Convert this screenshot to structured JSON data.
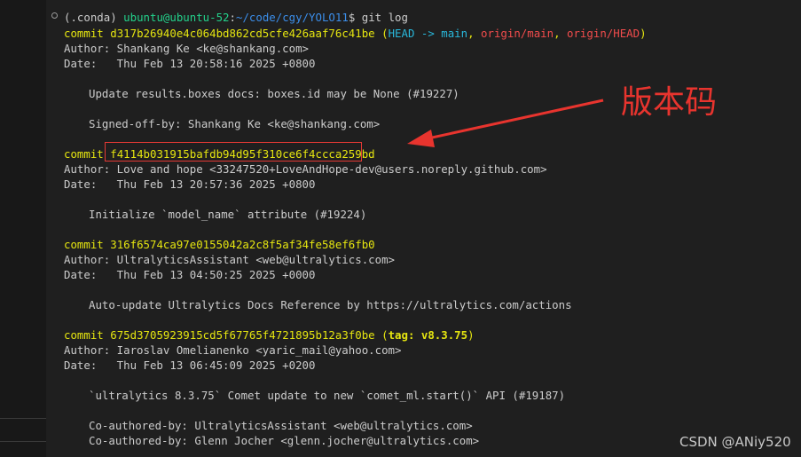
{
  "prompt": {
    "env": "(.conda)",
    "user_host": "ubuntu@ubuntu-52",
    "path": "~/code/cgy/YOLO11",
    "symbol": "$",
    "command": "git log"
  },
  "commits": [
    {
      "hash": "d317b26940e4c064bd862cd5cfe426aaf76c41be",
      "refs": {
        "head": "HEAD -> main",
        "remote1": "origin/main",
        "remote2": "origin/HEAD"
      },
      "author": "Author: Shankang Ke <ke@shankang.com>",
      "date": "Date:   Thu Feb 13 20:58:16 2025 +0800",
      "message": "Update results.boxes docs: boxes.id may be None (#19227)",
      "trailer1": "Signed-off-by: Shankang Ke <ke@shankang.com>"
    },
    {
      "hash": "f4114b031915bafdb94d95f310ce6f4ccca259bd",
      "author": "Author: Love and hope <33247520+LoveAndHope-dev@users.noreply.github.com>",
      "date": "Date:   Thu Feb 13 20:57:36 2025 +0800",
      "message": "Initialize `model_name` attribute (#19224)"
    },
    {
      "hash": "316f6574ca97e0155042a2c8f5af34fe58ef6fb0",
      "author": "Author: UltralyticsAssistant <web@ultralytics.com>",
      "date": "Date:   Thu Feb 13 04:50:25 2025 +0000",
      "message": "Auto-update Ultralytics Docs Reference by https://ultralytics.com/actions"
    },
    {
      "hash": "675d3705923915cd5f67765f4721895b12a3f0be",
      "tag": "tag: v8.3.75",
      "author": "Author: Iaroslav Omelianenko <yaric_mail@yahoo.com>",
      "date": "Date:   Thu Feb 13 06:45:09 2025 +0200",
      "message": "`ultralytics 8.3.75` Comet update to new `comet_ml.start()` API (#19187)",
      "trailer1": "Co-authored-by: UltralyticsAssistant <web@ultralytics.com>",
      "trailer2": "Co-authored-by: Glenn Jocher <glenn.jocher@ultralytics.com>"
    }
  ],
  "commit_keyword": "commit",
  "annotation": "版本码",
  "watermark": "CSDN @ANiy520",
  "colors": {
    "annotation_red": "#e8342e",
    "hash_yellow": "#e5e510"
  }
}
